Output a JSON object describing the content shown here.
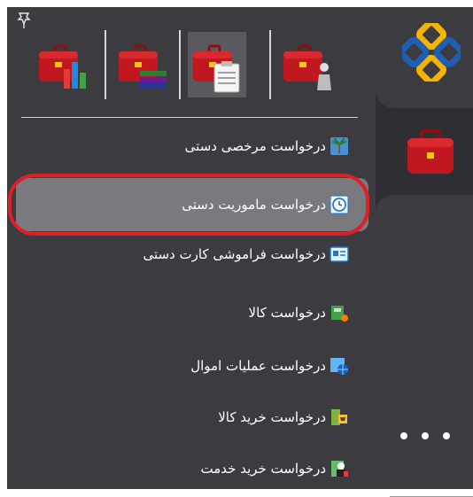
{
  "toolbar": {
    "icons": [
      "briefcase-chart-icon",
      "briefcase-stack-icon",
      "briefcase-clipboard-icon",
      "briefcase-person-icon"
    ],
    "active_index": 2
  },
  "menu": {
    "items": [
      {
        "label": "درخواست مرخصی دستی",
        "icon": "palm-tree-icon"
      },
      {
        "label": "درخواست ماموریت دستی",
        "icon": "clock-icon",
        "selected": true
      },
      {
        "label": "درخواست فراموشی کارت دستی",
        "icon": "id-card-icon"
      },
      {
        "label": "درخواست کالا",
        "icon": "goods-icon"
      },
      {
        "label": "درخواست عملیات اموال",
        "icon": "assets-globe-icon"
      },
      {
        "label": "درخواست خرید کالا",
        "icon": "purchase-cart-icon"
      },
      {
        "label": "درخواست خرید خدمت",
        "icon": "service-person-icon"
      }
    ]
  },
  "side_rail": {
    "icons": [
      "app-logo-icon",
      "briefcase-icon",
      "more-icon"
    ]
  },
  "colors": {
    "panel": "#3c3c40",
    "rail": "#2f2f33",
    "briefcase": "#c0181e",
    "highlight": "#e01e25",
    "selected": "#7a7a7e"
  }
}
